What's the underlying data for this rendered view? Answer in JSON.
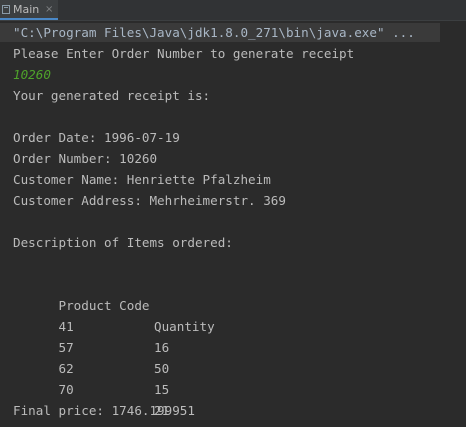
{
  "tab": {
    "label": "Main",
    "close": "×",
    "icon": "run-config-icon"
  },
  "console": {
    "command_line": "\"C:\\Program Files\\Java\\jdk1.8.0_271\\bin\\java.exe\" ...",
    "prompt": "Please Enter Order Number to generate receipt",
    "user_input": "10260",
    "receipt_header": "Your generated receipt is:",
    "order_date": "Order Date: 1996-07-19",
    "order_number": "Order Number: 10260",
    "customer_name": "Customer Name: Henriette Pfalzheim",
    "customer_address": "Customer Address: Mehrheimerstr. 369",
    "items_header": "Description of Items ordered:",
    "table": {
      "headers": [
        "Product Code",
        "Quantity"
      ],
      "rows": [
        [
          "41",
          "16"
        ],
        [
          "57",
          "50"
        ],
        [
          "62",
          "15"
        ],
        [
          "70",
          "21"
        ]
      ]
    },
    "final_price": "Final price: 1746.199951"
  },
  "colors": {
    "background": "#2b2b2b",
    "text": "#bbbbbb",
    "input": "#4fa32b",
    "tab_accent": "#4a88c7"
  }
}
